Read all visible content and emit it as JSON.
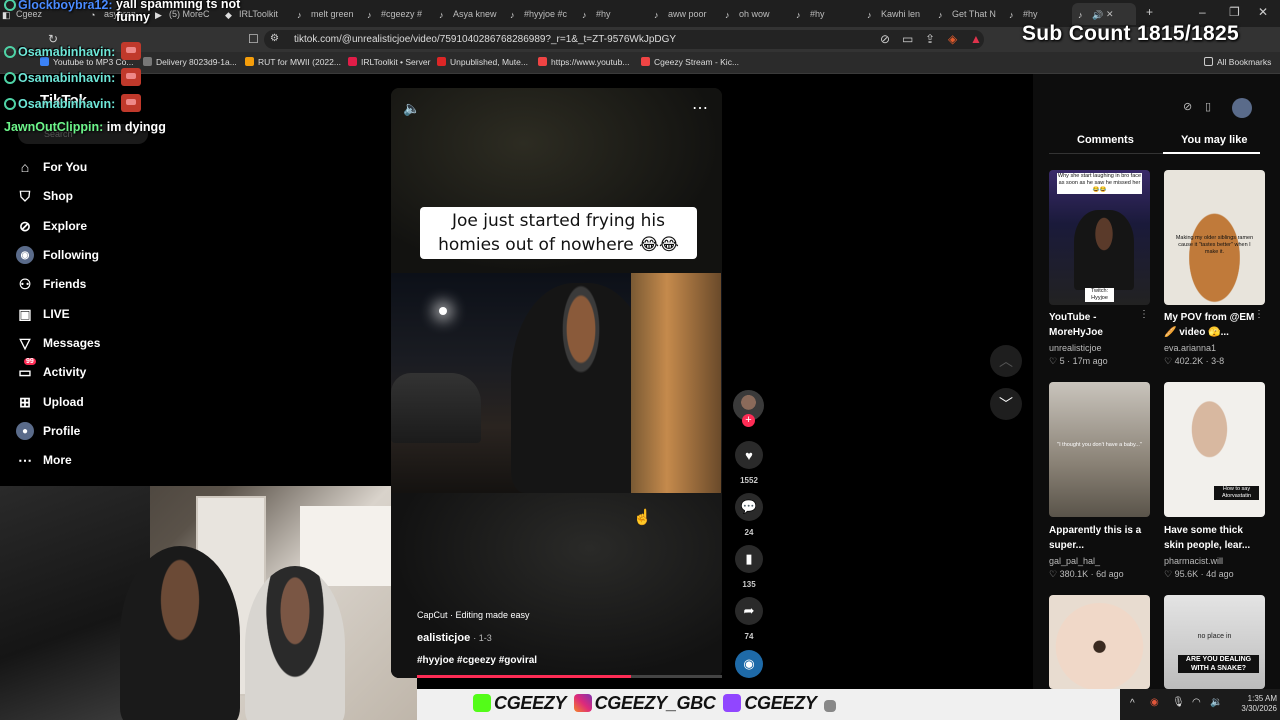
{
  "browser": {
    "tabs": [
      {
        "label": "Cgeezy Stream"
      },
      {
        "label": "asyaran"
      },
      {
        "label": "(5) MoreC"
      },
      {
        "label": "IRLToolkit"
      },
      {
        "label": "melt green"
      },
      {
        "label": "#cgeezy #"
      },
      {
        "label": "Asya knew"
      },
      {
        "label": "#hyyjoe #c"
      },
      {
        "label": "#hy"
      },
      {
        "label": "aww poor"
      },
      {
        "label": "oh wow"
      },
      {
        "label": "#hy"
      },
      {
        "label": "Kawhi len"
      },
      {
        "label": "Get That N"
      },
      {
        "label": "#hy"
      }
    ],
    "url": "tiktok.com/@unrealisticjoe/video/7591040286768286989?_r=1&_t=ZT-9576WkJpDGY",
    "bookmarks": [
      {
        "label": "Youtube to MP3 Co...",
        "color": "#3b82f6"
      },
      {
        "label": "Delivery 8023d9-1a...",
        "color": "#777777"
      },
      {
        "label": "RUT for MWII (2022...",
        "color": "#f59e0b"
      },
      {
        "label": "IRLToolkit • Server",
        "color": "#e11d48"
      },
      {
        "label": "Unpublished, Mute...",
        "color": "#dc2626"
      },
      {
        "label": "https://www.youtub...",
        "color": "#ef4444"
      },
      {
        "label": "Cgeezy Stream - Kic...",
        "color": "#ef4444"
      }
    ],
    "all_bookmarks": "All Bookmarks"
  },
  "overlay": {
    "sub_count": "Sub Count 1815/1825",
    "chat": [
      {
        "name": "Glockboybra12:",
        "message": "yall spamming ts not funny",
        "color": "blue"
      },
      {
        "name": "Osamabinhavin:",
        "message": "",
        "color": "teal"
      },
      {
        "name": "Osamabinhavin:",
        "message": "",
        "color": "teal"
      },
      {
        "name": "Osamabinhavin:",
        "message": "",
        "color": "teal"
      },
      {
        "name": "JawnOutClippin:",
        "message": "im dyingg",
        "color": "green"
      }
    ],
    "banner_handles": [
      "CGEEZY",
      "CGEEZY_GBC",
      "CGEEZY"
    ]
  },
  "tiktok": {
    "logo": "TikTok",
    "search_placeholder": "Search",
    "nav": [
      {
        "label": "For You",
        "icon": "home-icon",
        "glyph": "⌂"
      },
      {
        "label": "Shop",
        "icon": "shop-bag-icon",
        "glyph": "🛍"
      },
      {
        "label": "Explore",
        "icon": "compass-icon",
        "glyph": "⊘"
      },
      {
        "label": "Following",
        "icon": "following-icon",
        "glyph": "◉"
      },
      {
        "label": "Friends",
        "icon": "friends-icon",
        "glyph": "👥"
      },
      {
        "label": "LIVE",
        "icon": "live-icon",
        "glyph": "▣"
      },
      {
        "label": "Messages",
        "icon": "messages-icon",
        "glyph": "▽"
      },
      {
        "label": "Activity",
        "icon": "activity-icon",
        "glyph": "▭"
      },
      {
        "label": "Upload",
        "icon": "upload-icon",
        "glyph": "⊞"
      },
      {
        "label": "Profile",
        "icon": "profile-avatar-icon",
        "glyph": "●"
      },
      {
        "label": "More",
        "icon": "more-dots-icon",
        "glyph": "⋯"
      }
    ],
    "activity_badge": "99",
    "video": {
      "caption": "Joe just started frying his homies out of nowhere 😂😂",
      "capcut": "CapCut · Editing made easy",
      "author": "ealisticjoe",
      "date": "· 1-3",
      "hashtags": "#hyyjoe #cgeezy #goviral",
      "progress": 0.7
    },
    "actions": {
      "likes": "1552",
      "comments": "24",
      "saves": "135",
      "shares": "74"
    },
    "panel": {
      "tabs": [
        "Comments",
        "You may like"
      ],
      "active_tab": "You may like",
      "items": [
        {
          "title": "YouTube - MoreHyJoe",
          "author": "unrealisticjoe",
          "stats": "♡ 5 · 17m ago",
          "overlay": "Why she start laughing in bro face as soon as he saw he missed her 😂😂",
          "tag": "Twitch: Hyyjoe"
        },
        {
          "title": "My POV from @EM🥖 video 🫣...",
          "author": "eva.arianna1",
          "stats": "♡ 402.2K · 3-8",
          "overlay": "Making my older siblings ramen cause it \"tastes better\" when I make it.",
          "tag": ""
        },
        {
          "title": "Apparently this is a super...",
          "author": "gal_pal_hal_",
          "stats": "♡ 380.1K · 6d ago",
          "overlay": "\"I thought you don't have a baby...\"",
          "tag": ""
        },
        {
          "title": "Have some thick skin people, lear...",
          "author": "pharmacist.will",
          "stats": "♡ 95.6K · 4d ago",
          "overlay": "How to say Atorvastatin",
          "tag": ""
        },
        {
          "title": "",
          "author": "",
          "stats": "",
          "overlay": "",
          "tag": ""
        },
        {
          "title": "",
          "author": "",
          "stats": "",
          "overlay": "ARE YOU DEALING WITH A SNAKE?",
          "tag": "no place in"
        }
      ]
    }
  },
  "taskbar": {
    "time": "1:35 AM",
    "date": "3/30/2026"
  }
}
